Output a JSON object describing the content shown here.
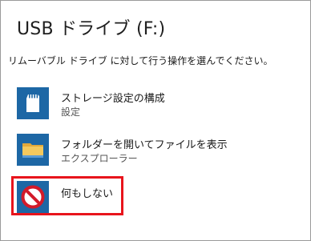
{
  "dialog": {
    "title": "USB ドライブ (F:)",
    "instruction": "リムーバブル ドライブ に対して行う操作を選んでください。"
  },
  "options": [
    {
      "label": "ストレージ設定の構成",
      "sublabel": "設定",
      "icon": "sd-card-icon"
    },
    {
      "label": "フォルダーを開いてファイルを表示",
      "sublabel": "エクスプローラー",
      "icon": "folder-icon"
    },
    {
      "label": "何もしない",
      "icon": "no-action-icon"
    }
  ],
  "colors": {
    "tile": "#1d67a5",
    "highlight": "#e8141c",
    "folder": "#f4c95d",
    "no_sign": "#d31a2a"
  }
}
